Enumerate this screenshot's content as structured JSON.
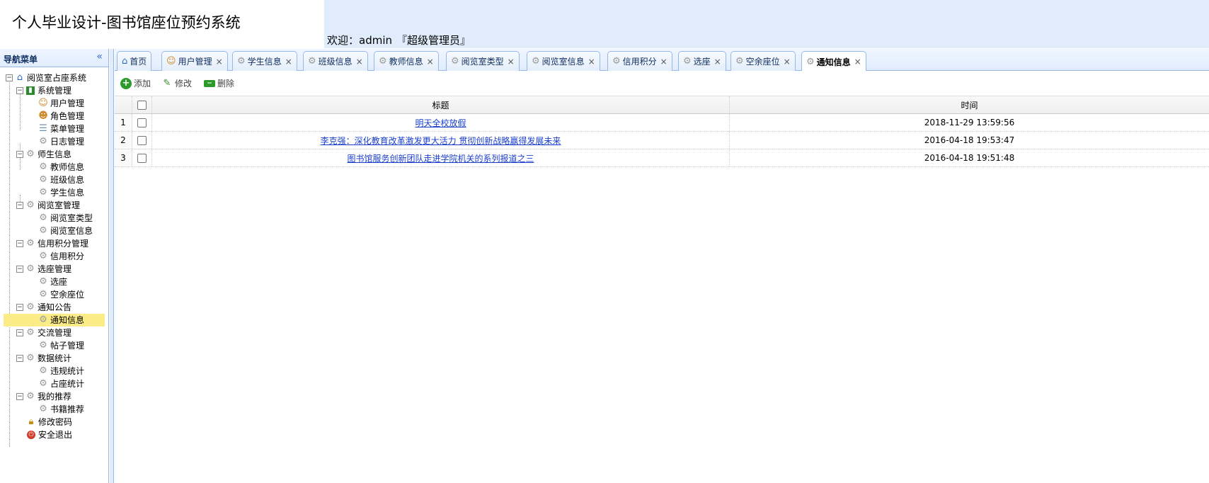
{
  "header": {
    "app_title": "个人毕业设计-图书馆座位预约系统",
    "welcome_prefix": "欢迎：admin",
    "welcome_role": "『超级管理员』"
  },
  "sidebar": {
    "title": "导航菜单",
    "collapse_glyph": "«",
    "tree": {
      "root": "阅览室占座系统",
      "system_mgmt": "系统管理",
      "user_mgmt": "用户管理",
      "role_mgmt": "角色管理",
      "menu_mgmt": "菜单管理",
      "log_mgmt": "日志管理",
      "teacher_student": "师生信息",
      "teacher_info": "教师信息",
      "class_info": "班级信息",
      "student_info": "学生信息",
      "reading_room_mgmt": "阅览室管理",
      "room_type": "阅览室类型",
      "room_info": "阅览室信息",
      "credit_mgmt": "信用积分管理",
      "credit_points": "信用积分",
      "seat_mgmt": "选座管理",
      "choose_seat": "选座",
      "free_seats": "空余座位",
      "notice": "通知公告",
      "notice_info": "通知信息",
      "exchange_mgmt": "交流管理",
      "post_mgmt": "帖子管理",
      "data_stats": "数据统计",
      "violation_stats": "违规统计",
      "seat_stats": "占座统计",
      "my_recommend": "我的推荐",
      "book_recommend": "书籍推荐",
      "change_password": "修改密码",
      "logout": "安全退出"
    }
  },
  "tabs": [
    {
      "label": "首页",
      "icon": "home-icon",
      "closable": false
    },
    {
      "label": "用户管理",
      "icon": "user-icon",
      "closable": true
    },
    {
      "label": "学生信息",
      "icon": "gear-icon",
      "closable": true
    },
    {
      "label": "班级信息",
      "icon": "gear-icon",
      "closable": true
    },
    {
      "label": "教师信息",
      "icon": "gear-icon",
      "closable": true
    },
    {
      "label": "阅览室类型",
      "icon": "gear-icon",
      "closable": true
    },
    {
      "label": "阅览室信息",
      "icon": "gear-icon",
      "closable": true
    },
    {
      "label": "信用积分",
      "icon": "gear-icon",
      "closable": true
    },
    {
      "label": "选座",
      "icon": "gear-icon",
      "closable": true
    },
    {
      "label": "空余座位",
      "icon": "gear-icon",
      "closable": true
    },
    {
      "label": "通知信息",
      "icon": "gear-icon",
      "closable": true,
      "active": true
    }
  ],
  "tab_close_glyph": "×",
  "toolbar": {
    "add_label": "添加",
    "edit_label": "修改",
    "delete_label": "删除"
  },
  "grid": {
    "columns": {
      "title": "标题",
      "time": "时间"
    },
    "rows": [
      {
        "num": "1",
        "title": "明天全校放假",
        "time": "2018-11-29 13:59:56"
      },
      {
        "num": "2",
        "title": "李克强：深化教育改革激发更大活力 贯彻创新战略赢得发展未来",
        "time": "2016-04-18 19:53:47"
      },
      {
        "num": "3",
        "title": "图书馆服务创新团队走进学院机关的系列报道之三",
        "time": "2016-04-18 19:51:48"
      }
    ]
  },
  "colors": {
    "header_bg": "#e0ecfb",
    "panel_border": "#95b8e7",
    "selected_node": "#fbec88",
    "link": "#1a3fcf"
  }
}
